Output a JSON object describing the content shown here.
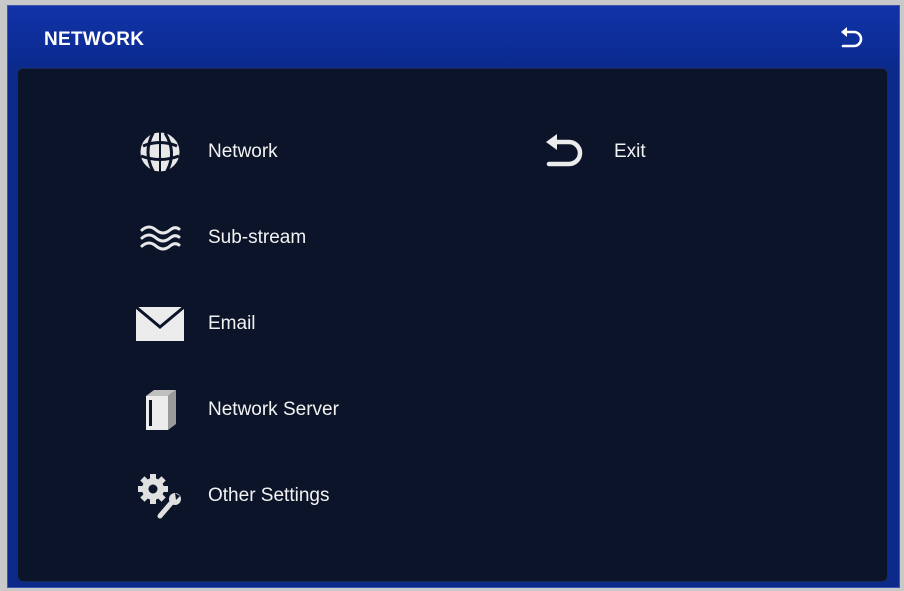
{
  "window": {
    "title": "NETWORK",
    "back_icon": "back-arrow-icon"
  },
  "menu": {
    "items": [
      {
        "label": "Network",
        "icon": "globe-icon"
      },
      {
        "label": "Sub-stream",
        "icon": "waves-icon"
      },
      {
        "label": "Email",
        "icon": "envelope-icon"
      },
      {
        "label": "Network Server",
        "icon": "server-icon"
      },
      {
        "label": "Other Settings",
        "icon": "gear-wrench-icon"
      }
    ],
    "exit": {
      "label": "Exit",
      "icon": "back-arrow-icon"
    }
  },
  "colors": {
    "titlebar": "#0b2a8a",
    "panel": "#0b1428",
    "text": "#f2f2f2"
  }
}
